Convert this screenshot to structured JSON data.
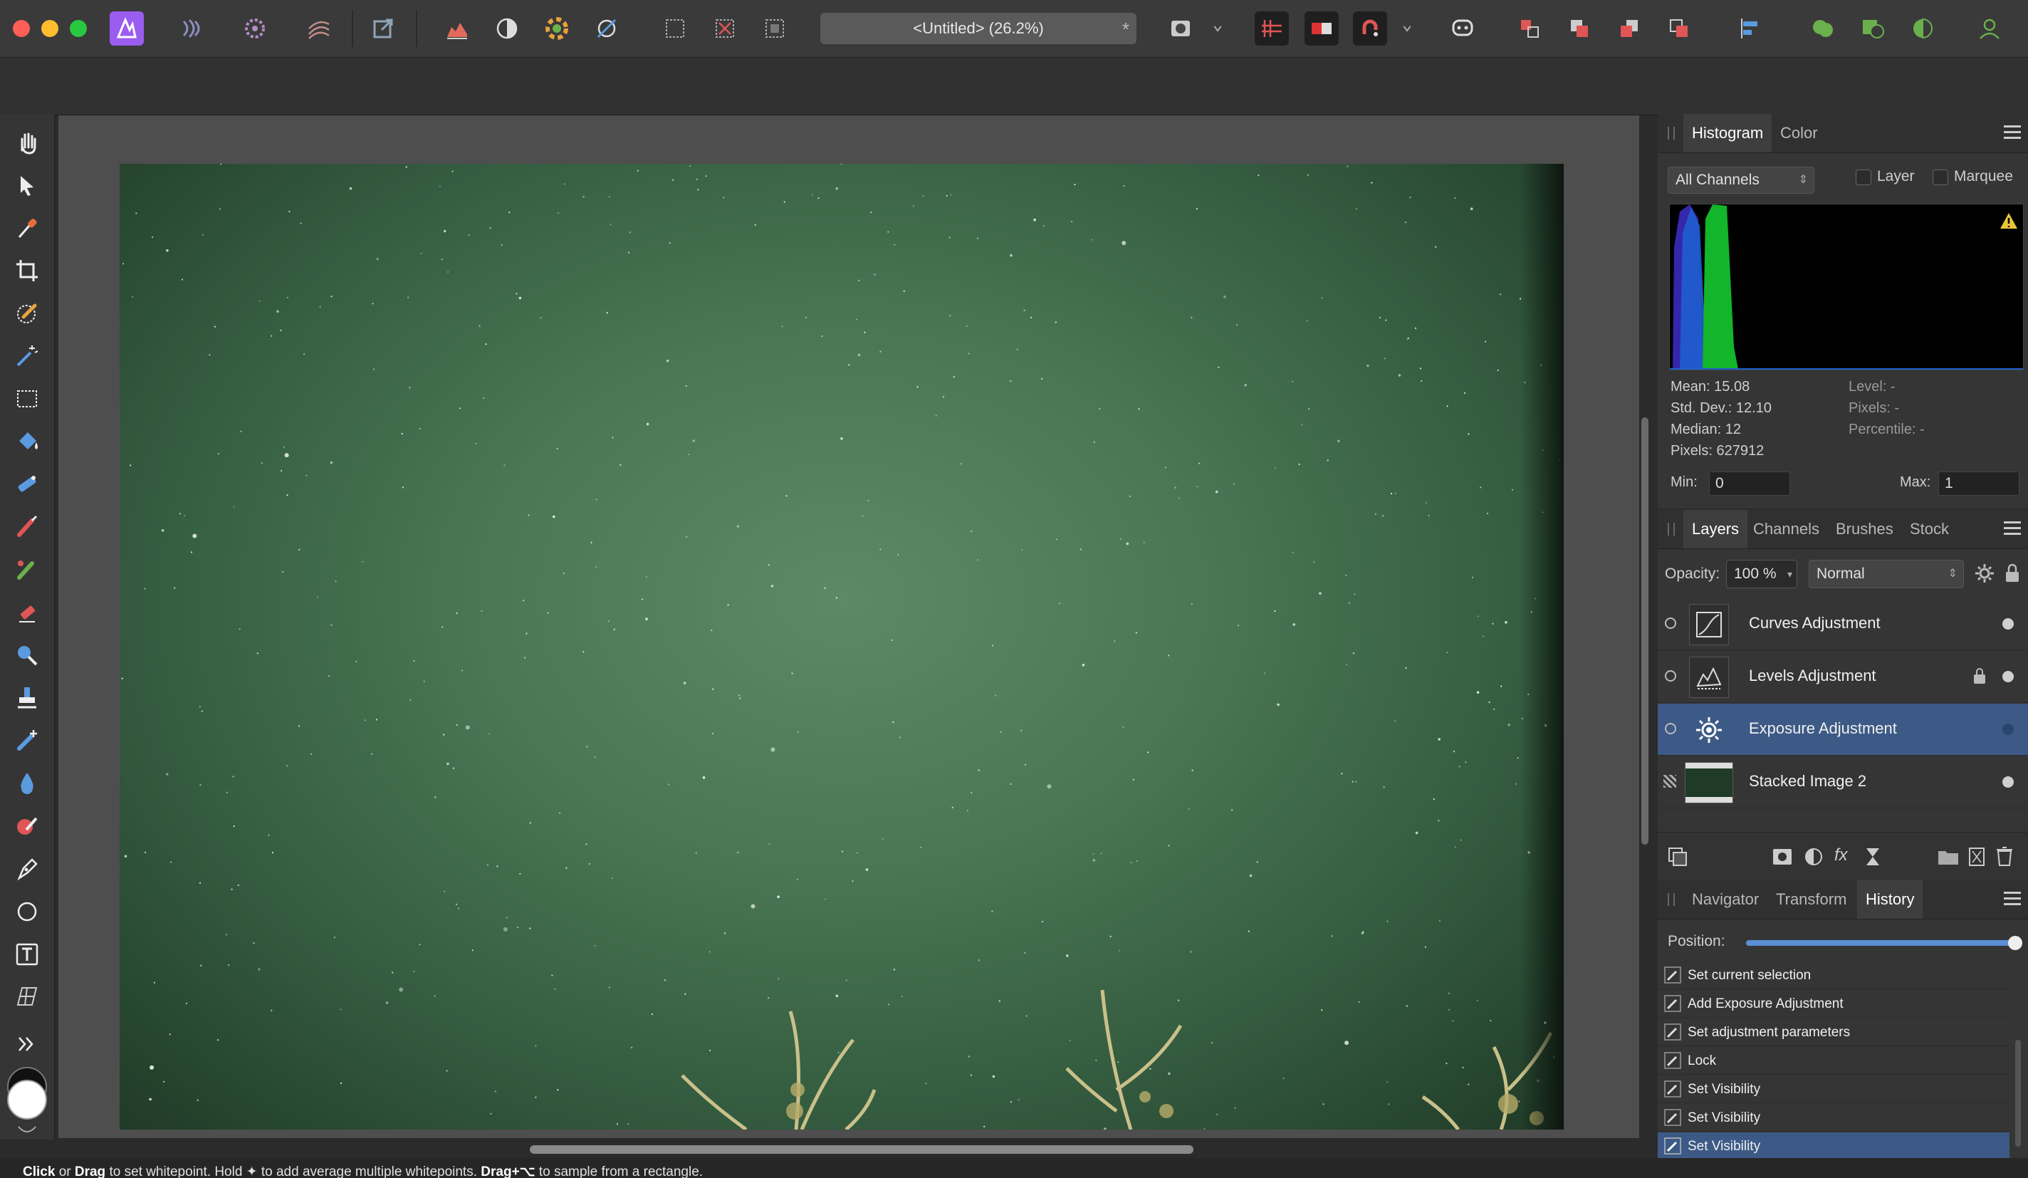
{
  "app": {
    "document_title": "<Untitled> (26.2%)",
    "modified_marker": "*"
  },
  "colors": {
    "accent": "#9b5cf0",
    "selection": "#3d5a86",
    "canvas_bg": "#4e4e4e",
    "photo_green": "#4a7855"
  },
  "status_bar": {
    "click": "Click",
    "or": " or ",
    "drag": "Drag",
    "rest1": " to set whitepoint. Hold ✦ to add average multiple whitepoints. ",
    "drag_alt": "Drag+⌥",
    "rest2": " to sample from a rectangle."
  },
  "histogram_panel": {
    "tabs": [
      "Histogram",
      "Color"
    ],
    "channel_select": "All Channels",
    "layer_check": "Layer",
    "marquee_check": "Marquee",
    "warning_icon": "warning-icon",
    "stats_left": [
      "Mean: 15.08",
      "Std. Dev.: 12.10",
      "Median: 12",
      "Pixels: 627912"
    ],
    "stats_right": [
      "Level: -",
      "Pixels: -",
      "Percentile: -"
    ],
    "min_label": "Min:",
    "min_value": "0",
    "max_label": "Max:",
    "max_value": "1"
  },
  "layers_panel": {
    "tabs": [
      "Layers",
      "Channels",
      "Brushes",
      "Stock"
    ],
    "opacity_label": "Opacity:",
    "opacity_value": "100 %",
    "blend_mode": "Normal",
    "layers": [
      {
        "name": "Curves Adjustment",
        "icon": "curves-icon",
        "locked": false,
        "selected": false
      },
      {
        "name": "Levels Adjustment",
        "icon": "levels-icon",
        "locked": true,
        "selected": false
      },
      {
        "name": "Exposure Adjustment",
        "icon": "exposure-icon",
        "locked": false,
        "selected": true
      },
      {
        "name": "Stacked Image 2",
        "icon": "image-thumbnail",
        "locked": false,
        "selected": false
      }
    ]
  },
  "history_panel": {
    "tabs": [
      "Navigator",
      "Transform",
      "History"
    ],
    "position_label": "Position:",
    "position_fraction": 1.0,
    "items": [
      {
        "label": "Set current selection",
        "selected": false
      },
      {
        "label": "Add Exposure Adjustment",
        "selected": false
      },
      {
        "label": "Set adjustment parameters",
        "selected": false
      },
      {
        "label": "Lock",
        "selected": false
      },
      {
        "label": "Set Visibility",
        "selected": false
      },
      {
        "label": "Set Visibility",
        "selected": false
      },
      {
        "label": "Set Visibility",
        "selected": true
      }
    ]
  }
}
